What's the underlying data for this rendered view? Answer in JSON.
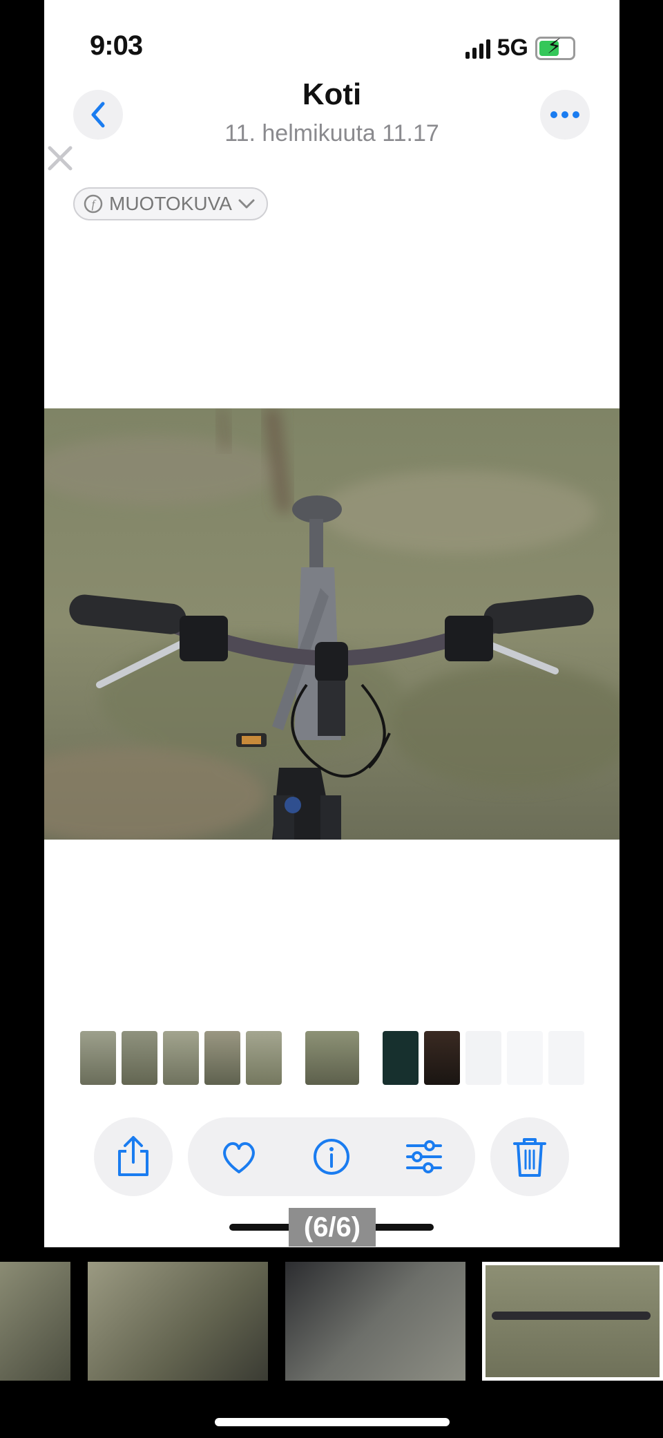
{
  "status": {
    "time": "9:03",
    "network": "5G"
  },
  "header": {
    "title": "Koti",
    "subtitle": "11. helmikuuta  11.17"
  },
  "badge": {
    "label": "MUOTOKUVA"
  },
  "counter": "(6/6)",
  "icons": [
    "chevron-left-icon",
    "more-icon",
    "close-icon",
    "share-icon",
    "heart-icon",
    "info-icon",
    "sliders-icon",
    "trash-icon"
  ],
  "colors": {
    "accent": "#1a7cf0",
    "toolbar_bg": "#f0f0f2",
    "battery": "#34c759"
  }
}
